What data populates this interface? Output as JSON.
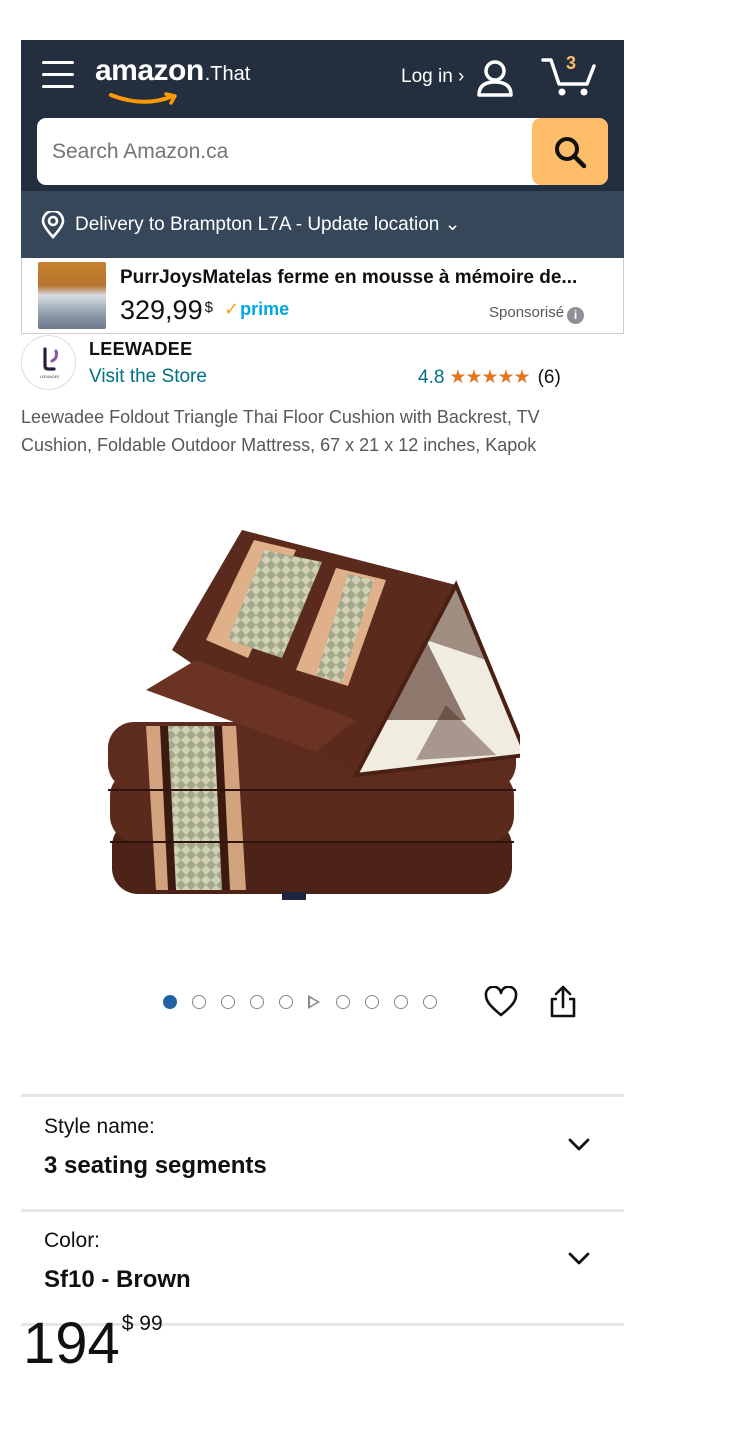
{
  "header": {
    "logo_text": "amazon",
    "logo_suffix": ".That",
    "login_label": "Log in ›",
    "cart_count": "3",
    "search_placeholder": "Search Amazon.ca",
    "delivery_text": "Delivery to Brampton L7A - Update location ⌄"
  },
  "ad": {
    "title": "PurrJoysMatelas ferme en mousse à mémoire de...",
    "price_main": "329,99",
    "price_currency": "$",
    "prime_label": "prime",
    "sponsored_label": "Sponsorisé"
  },
  "product": {
    "brand_name": "LEEWADEE",
    "brand_logo_text": "LEEWADEE",
    "visit_store": "Visit the Store",
    "rating": "4.8",
    "stars": "★★★★★",
    "rating_count": "(6)",
    "title": "Leewadee Foldout Triangle Thai Floor Cushion with Backrest, TV Cushion, Foldable Outdoor Mattress, 67 x 21 x 12 inches, Kapok",
    "image_count": 9,
    "active_image": 1
  },
  "variations": [
    {
      "label": "Style name:",
      "value": "3 seating segments"
    },
    {
      "label": "Color:",
      "value": "Sf10 - Brown"
    }
  ],
  "price": {
    "whole": "194",
    "fraction": "$ 99"
  },
  "colors": {
    "header_bg": "#232f3e",
    "delivery_bg": "#37475a",
    "search_button": "#febd69",
    "link": "#007185",
    "star": "#de7921",
    "active_dot": "#2162a1"
  }
}
